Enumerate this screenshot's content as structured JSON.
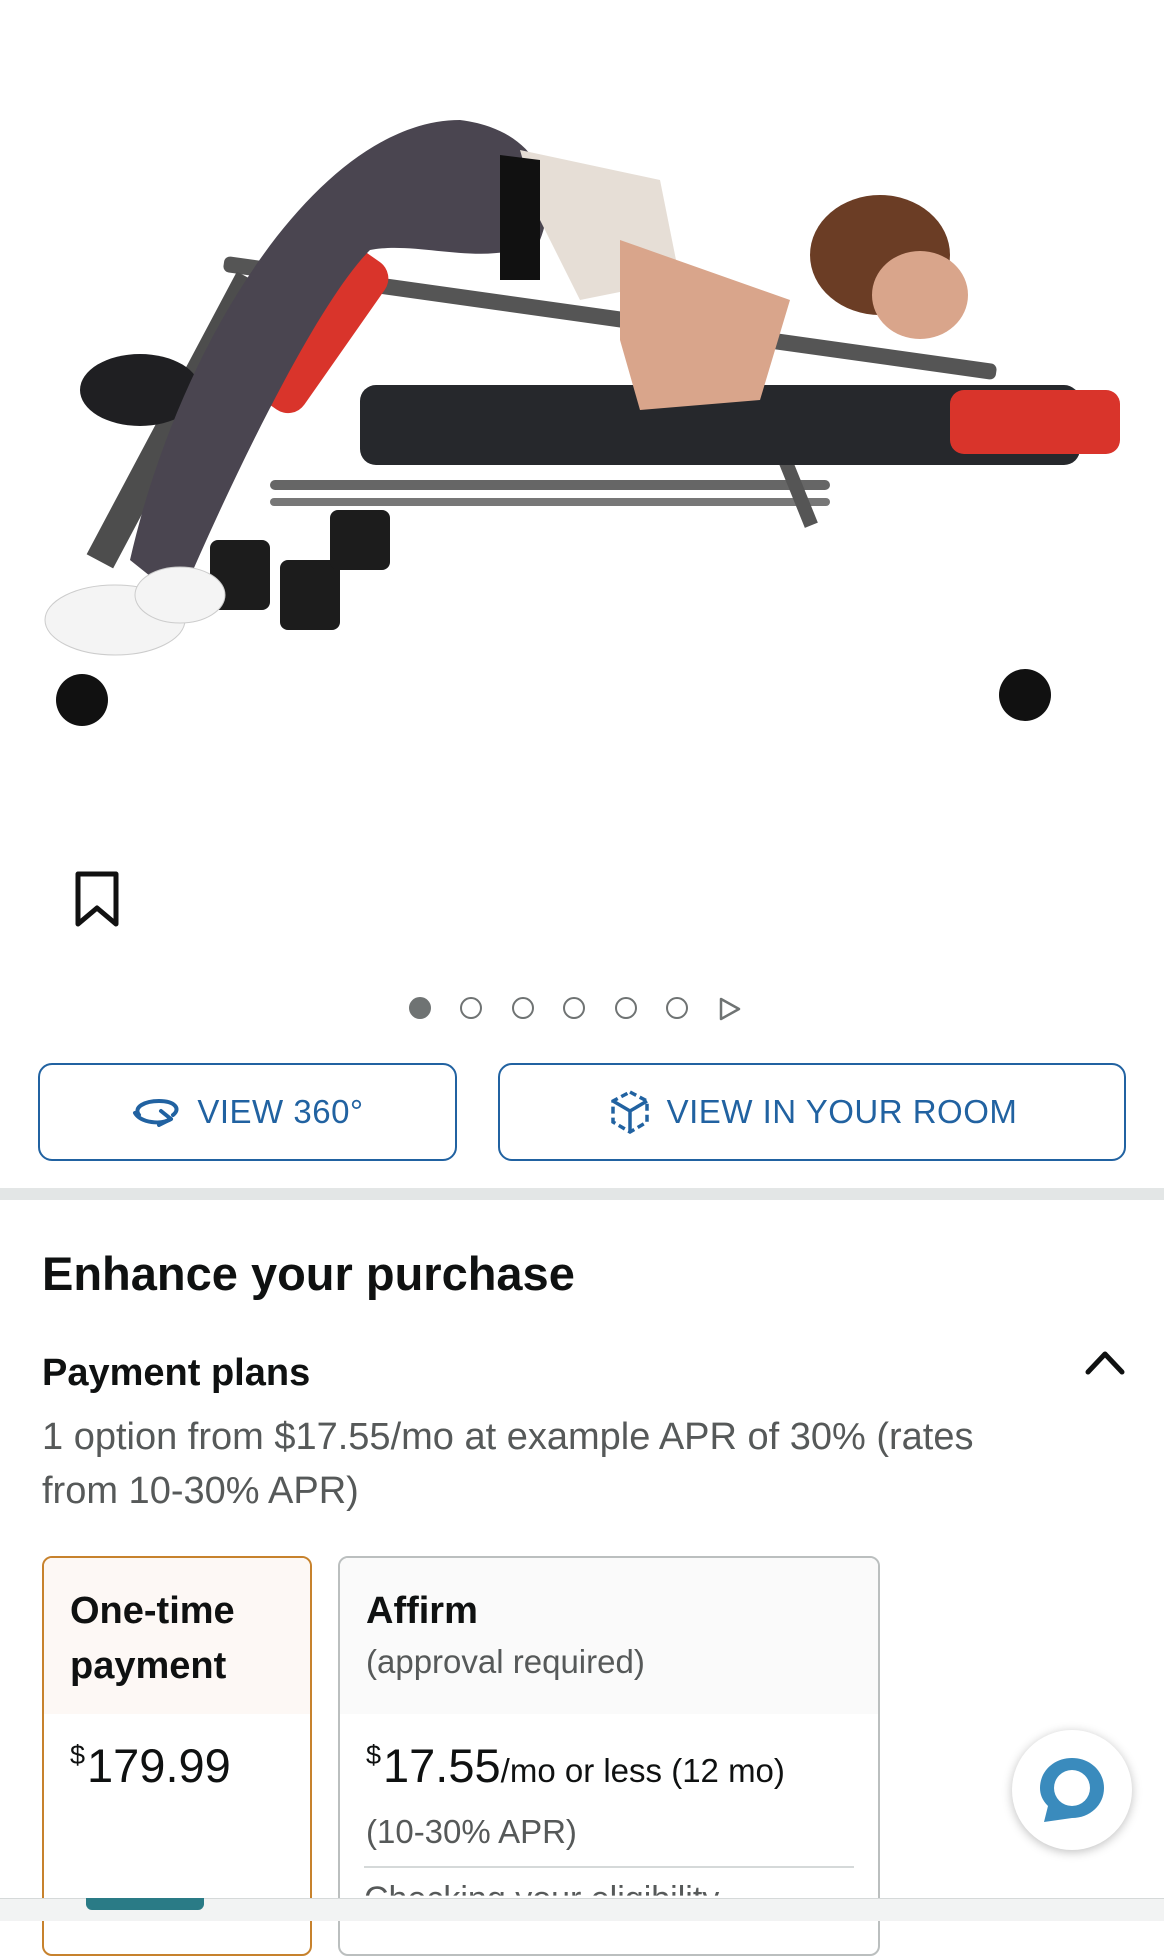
{
  "carousel": {
    "slides": 6,
    "active_index": 0
  },
  "buttons": {
    "view_360": "VIEW 360°",
    "view_in_room": "VIEW IN YOUR ROOM"
  },
  "enhance": {
    "title": "Enhance your purchase",
    "payment_plans": {
      "title": "Payment plans",
      "description": "1 option from $17.55/mo at example APR of 30% (rates from 10-30% APR)"
    }
  },
  "cards": {
    "onetime": {
      "title": "One-time payment",
      "currency": "$",
      "amount": "179.99"
    },
    "affirm": {
      "title": "Affirm",
      "subtitle": "(approval required)",
      "currency": "$",
      "amount": "17.55",
      "unit": "/mo or less (12 mo)",
      "apr": "(10-30% APR)",
      "cut_text": "Checking your eligibility"
    }
  },
  "colors": {
    "link_blue": "#2162a1",
    "selected_border": "#c7822d",
    "divider": "#e3e6e6",
    "chat_blue": "#3a8bbd"
  },
  "icons": [
    "bookmark-icon",
    "rotate-360-icon",
    "ar-cube-icon",
    "chevron-up-icon",
    "chat-bubble-icon",
    "play-icon"
  ]
}
